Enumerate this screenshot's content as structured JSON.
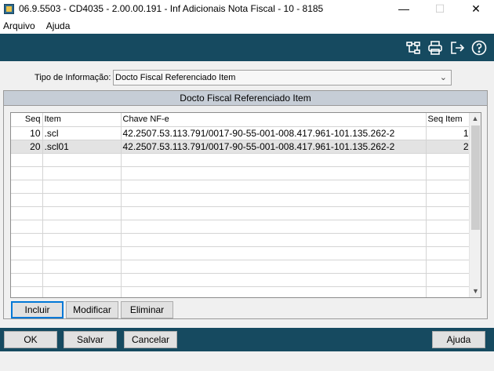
{
  "window": {
    "title": "06.9.5503 - CD4035 - 2.00.00.191 - Inf Adicionais Nota Fiscal - 10 - 8185",
    "minimize": "—",
    "maximize": "☐",
    "close": "✕"
  },
  "menu": [
    "Arquivo",
    "Ajuda"
  ],
  "toolbar": {
    "icons": [
      "hierarchy-icon",
      "print-icon",
      "exit-icon",
      "help-icon"
    ]
  },
  "form": {
    "tipo_label": "Tipo de Informação:",
    "tipo_value": "Docto Fiscal Referenciado Item"
  },
  "group": {
    "title": "Docto Fiscal Referenciado Item",
    "columns": [
      "Seq",
      "Item",
      "Chave NF-e",
      "Seq Item"
    ],
    "rows": [
      {
        "seq": "10",
        "item": ".scl",
        "chave": "42.2507.53.113.791/0017-90-55-001-008.417.961-101.135.262-2",
        "seq_item": "1"
      },
      {
        "seq": "20",
        "item": ".scl01",
        "chave": "42.2507.53.113.791/0017-90-55-001-008.417.961-101.135.262-2",
        "seq_item": "2"
      }
    ],
    "buttons": {
      "incluir": "Incluir",
      "modificar": "Modificar",
      "eliminar": "Eliminar"
    }
  },
  "footer": {
    "ok": "OK",
    "salvar": "Salvar",
    "cancelar": "Cancelar",
    "ajuda": "Ajuda"
  },
  "colors": {
    "toolbar_bg": "#164a60",
    "group_header_bg": "#c6cdd6",
    "selected_row_bg": "#e3e3e3",
    "focus_border": "#0078d7"
  }
}
